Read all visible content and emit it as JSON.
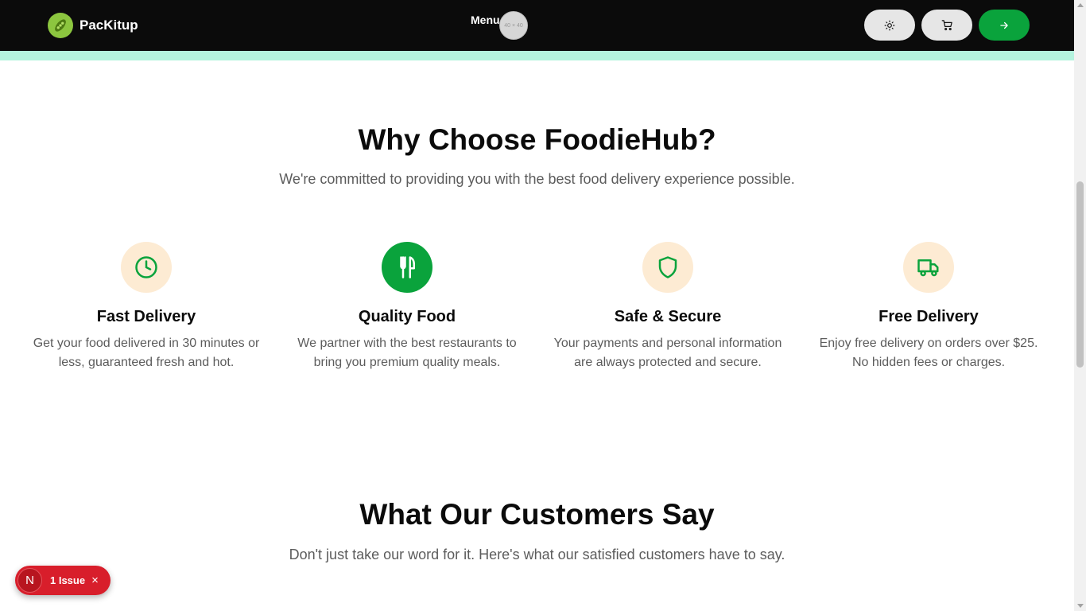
{
  "navbar": {
    "brand": "PacKitup",
    "menu_label": "Menu",
    "menu_avatar_text": "40 × 40",
    "buttons": [
      {
        "name": "theme-toggle-button",
        "icon": "sun-icon"
      },
      {
        "name": "cart-button",
        "icon": "cart-icon"
      },
      {
        "name": "proceed-button",
        "icon": "arrow-right-icon"
      }
    ]
  },
  "why": {
    "title": "Why Choose FoodieHub?",
    "subtitle": "We're committed to providing you with the best food delivery experience possible.",
    "features": [
      {
        "icon": "clock-icon",
        "title": "Fast Delivery",
        "line1": "Get your food delivered in 30 minutes or",
        "line2": "less, guaranteed fresh and hot."
      },
      {
        "icon": "utensils-icon",
        "title": "Quality Food",
        "line1": "We partner with the best restaurants to",
        "line2": "bring you premium quality meals."
      },
      {
        "icon": "shield-icon",
        "title": "Safe & Secure",
        "line1": "Your payments and personal information",
        "line2": "are always protected and secure."
      },
      {
        "icon": "truck-icon",
        "title": "Free Delivery",
        "line1": "Enjoy free delivery on orders over $25.",
        "line2": "No hidden fees or charges."
      }
    ]
  },
  "testimonials": {
    "title": "What Our Customers Say",
    "subtitle": "Don't just take our word for it. Here's what our satisfied customers have to say."
  },
  "dev_indicator": {
    "letter": "N",
    "label": "1 Issue",
    "close": "×"
  },
  "colors": {
    "navbar_bg": "#0b0b0b",
    "accent_green": "#0aa33c",
    "strip_mint": "#b4f3de",
    "icon_bg_peach": "#fdebd3",
    "issue_red": "#d81e2b"
  }
}
